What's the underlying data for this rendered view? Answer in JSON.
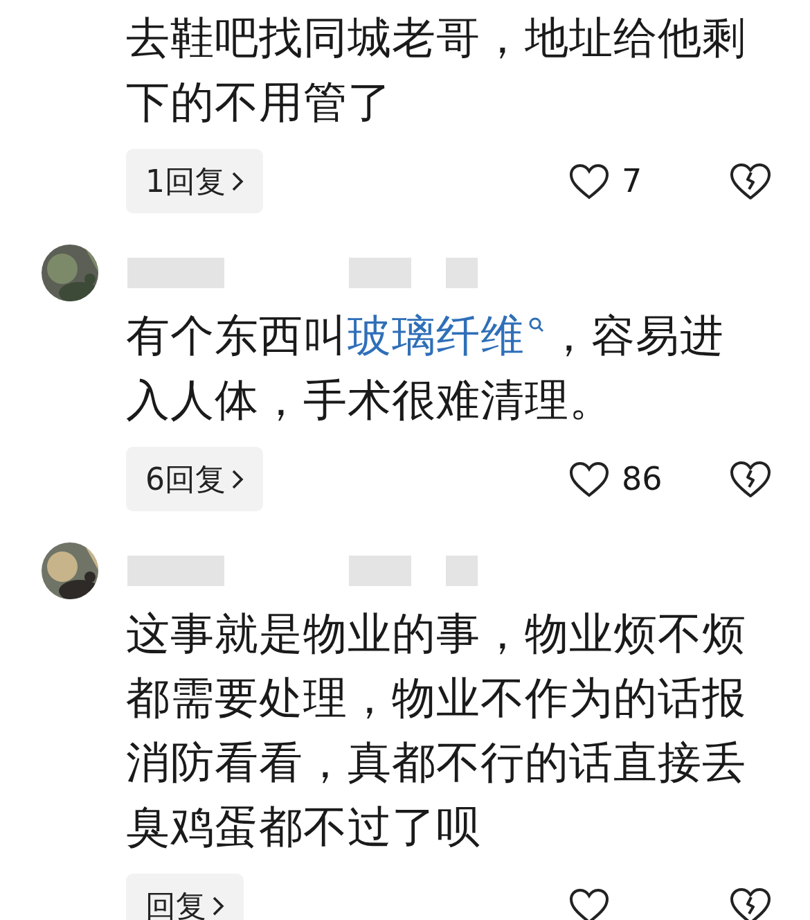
{
  "comments": [
    {
      "header": false,
      "text": "去鞋吧找同城老哥，地址给他剩下的不用管了",
      "replies": "1回复",
      "likes": "7"
    },
    {
      "header": true,
      "text": "有个东西叫",
      "link": "玻璃纤维",
      "text_after": "，容易进入人体，手术很难清理。",
      "replies": "6回复",
      "likes": "86"
    },
    {
      "header": true,
      "text": "这事就是物业的事，物业烦不烦都需要处理，物业不作为的话报消防看看，真都不行的话直接丢臭鸡蛋都不过了呗",
      "replies": "回复"
    }
  ]
}
